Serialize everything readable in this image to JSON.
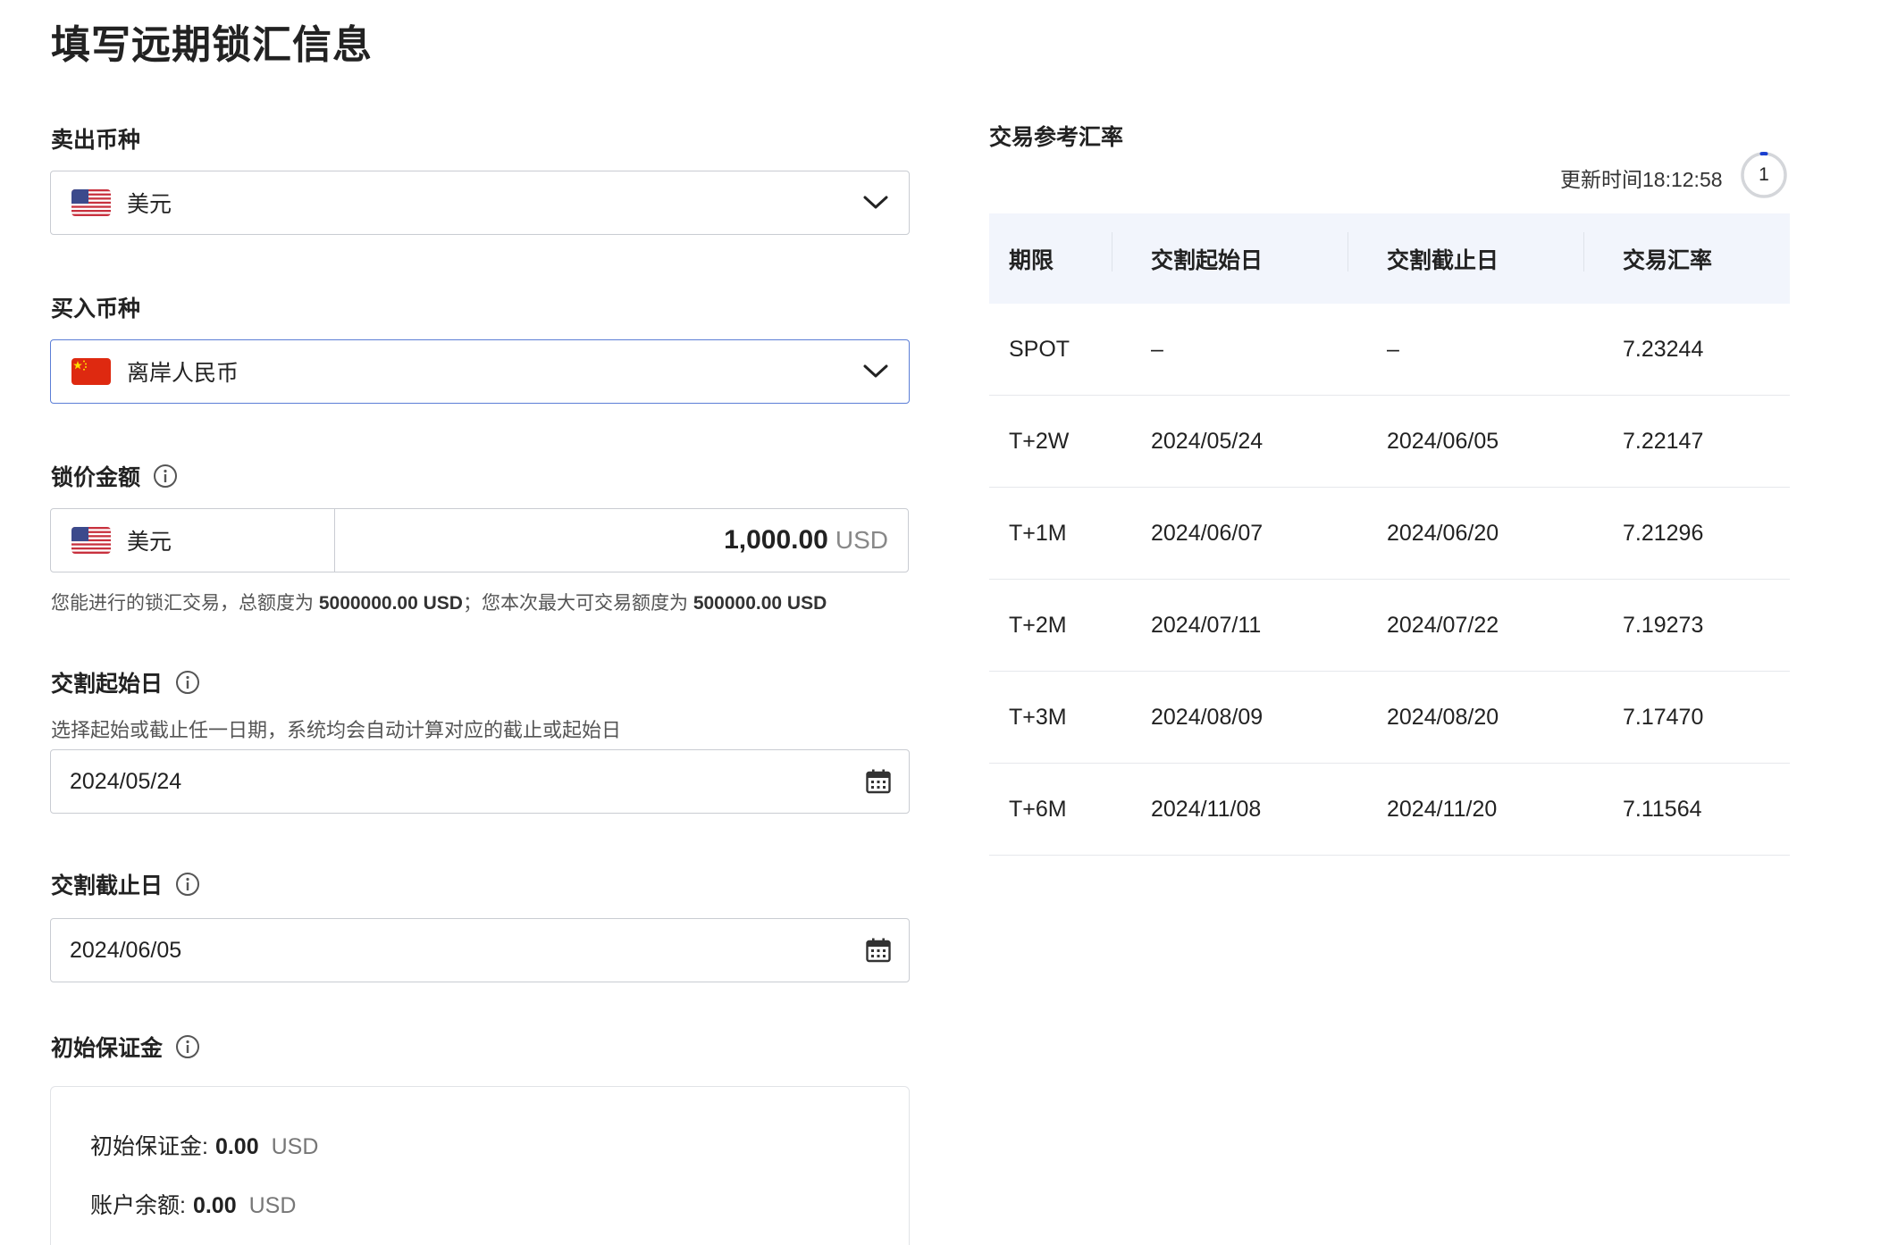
{
  "title": "填写远期锁汇信息",
  "sell": {
    "label": "卖出币种",
    "value": "美元",
    "flag": "us-flag-icon"
  },
  "buy": {
    "label": "买入币种",
    "value": "离岸人民币",
    "flag": "cn-flag-icon"
  },
  "amount": {
    "label": "锁价金额",
    "currency": "美元",
    "value": "1,000.00",
    "unit": "USD",
    "hint_prefix": "您能进行的锁汇交易，总额度为 ",
    "total_limit": "5000000.00 USD",
    "hint_middle": "；您本次最大可交易额度为 ",
    "max_limit": "500000.00 USD"
  },
  "start_date": {
    "label": "交割起始日",
    "hint": "选择起始或截止任一日期，系统均会自动计算对应的截止或起始日",
    "value": "2024/05/24"
  },
  "end_date": {
    "label": "交割截止日",
    "value": "2024/06/05"
  },
  "margin": {
    "label": "初始保证金",
    "initial_label": "初始保证金:",
    "initial_value": "0.00",
    "initial_unit": "USD",
    "balance_label": "账户余额:",
    "balance_value": "0.00",
    "balance_unit": "USD"
  },
  "rates": {
    "title": "交易参考汇率",
    "update_time": "更新时间18:12:58",
    "countdown": "1",
    "headers": [
      "期限",
      "交割起始日",
      "交割截止日",
      "交易汇率"
    ],
    "rows": [
      {
        "term": "SPOT",
        "start": "–",
        "end": "–",
        "rate": "7.23244"
      },
      {
        "term": "T+2W",
        "start": "2024/05/24",
        "end": "2024/06/05",
        "rate": "7.22147"
      },
      {
        "term": "T+1M",
        "start": "2024/06/07",
        "end": "2024/06/20",
        "rate": "7.21296"
      },
      {
        "term": "T+2M",
        "start": "2024/07/11",
        "end": "2024/07/22",
        "rate": "7.19273"
      },
      {
        "term": "T+3M",
        "start": "2024/08/09",
        "end": "2024/08/20",
        "rate": "7.17470"
      },
      {
        "term": "T+6M",
        "start": "2024/11/08",
        "end": "2024/11/20",
        "rate": "7.11564"
      }
    ]
  },
  "colors": {
    "focus_border": "#5b7ed6",
    "table_header_bg": "#f2f5fc",
    "countdown_accent": "#1a3fcf"
  }
}
